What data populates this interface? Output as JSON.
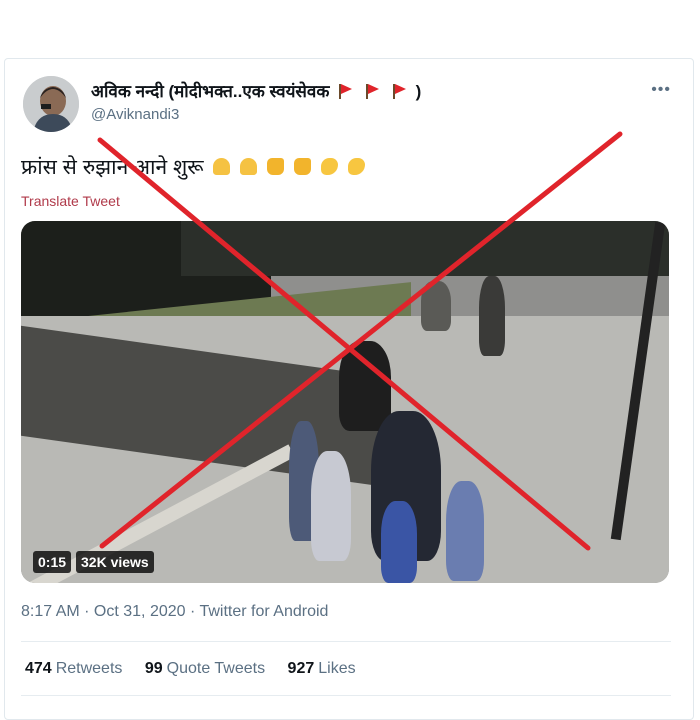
{
  "tweet": {
    "display_name": "अविक नन्दी (मोदीभक्त..एक स्वयंसेवक",
    "display_name_suffix": ")",
    "handle": "@Aviknandi3",
    "text": "फ्रांस से रुझान आने शुरू",
    "translate_label": "Translate Tweet",
    "video": {
      "duration": "0:15",
      "views": "32K views"
    },
    "timestamp": "8:17 AM · Oct 31, 2020 · Twitter for Android",
    "stats": {
      "retweets_count": "474",
      "retweets_label": "Retweets",
      "quote_tweets_count": "99",
      "quote_tweets_label": "Quote Tweets",
      "likes_count": "927",
      "likes_label": "Likes"
    }
  },
  "icons": {
    "more": "more-icon",
    "flag": "red-flag-icon",
    "emoji": [
      "folded-hands",
      "folded-hands",
      "thumbs-up",
      "thumbs-up",
      "flexed-biceps",
      "flexed-biceps"
    ]
  },
  "colors": {
    "cross_mark": "#e0242b",
    "translate_link": "#b03a4a",
    "secondary_text": "#5b7083"
  }
}
